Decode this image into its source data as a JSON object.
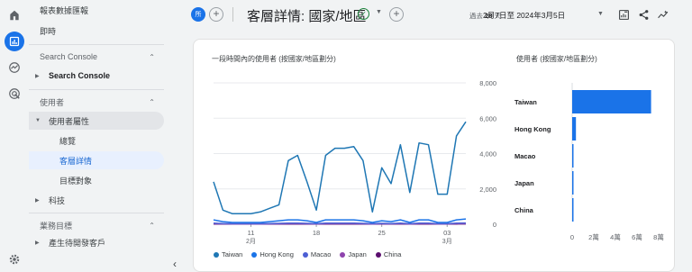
{
  "nav": {
    "reports_snapshot": "報表數據匯報",
    "realtime": "即時",
    "search_console_section": "Search Console",
    "search_console_item": "Search Console",
    "users_section": "使用者",
    "user_attributes": "使用者屬性",
    "overview": "總覽",
    "demographic_details": "客層詳情",
    "audiences": "目標對象",
    "tech": "科技",
    "business_goals": "業務目標",
    "leads": "產生待開發客戶"
  },
  "header": {
    "all_badge": "所",
    "title": "客層詳情: 國家/地區",
    "date_prefix": "過去",
    "date_days": "28",
    "date_unit": "天",
    "date_range": "2月7日至 2024年3月5日"
  },
  "line_chart_title": "一段時間內的使用者 (按國家/地區劃分)",
  "bar_chart_title": "使用者 (按國家/地區劃分)",
  "colors": {
    "accent": "#1a73e8",
    "Taiwan": "#1f77b4",
    "Hong Kong": "#1a73e8",
    "Macao": "#4d5fd4",
    "Japan": "#8e44ad",
    "China": "#5b0e6e"
  },
  "chart_data": [
    {
      "type": "line",
      "x": [
        "2月7日",
        "2月8日",
        "2月9日",
        "2月10日",
        "2月11日",
        "2月12日",
        "2月13日",
        "2月14日",
        "2月15日",
        "2月16日",
        "2月17日",
        "2月18日",
        "2月19日",
        "2月20日",
        "2月21日",
        "2月22日",
        "2月23日",
        "2月24日",
        "2月25日",
        "2月26日",
        "2月27日",
        "2月28日",
        "2月29日",
        "3月1日",
        "3月2日",
        "3月3日",
        "3月4日",
        "3月5日"
      ],
      "xticks": [
        {
          "label": "11",
          "sub": "2月",
          "x": "2月11日"
        },
        {
          "label": "18",
          "sub": "",
          "x": "2月18日"
        },
        {
          "label": "25",
          "sub": "",
          "x": "2月25日"
        },
        {
          "label": "03",
          "sub": "3月",
          "x": "3月3日"
        }
      ],
      "yticks": [
        "0",
        "2,000",
        "4,000",
        "6,000",
        "8,000"
      ],
      "ylim": [
        0,
        8000
      ],
      "grid": true,
      "series": [
        {
          "name": "Taiwan",
          "values": [
            2400,
            800,
            600,
            600,
            600,
            700,
            900,
            1100,
            3600,
            3900,
            2400,
            800,
            3900,
            4300,
            4300,
            4400,
            3600,
            700,
            3200,
            2300,
            4500,
            1800,
            4600,
            4500,
            1700,
            1700,
            5000,
            5800
          ]
        },
        {
          "name": "Hong Kong",
          "values": [
            250,
            150,
            100,
            100,
            100,
            100,
            150,
            200,
            250,
            250,
            200,
            100,
            250,
            250,
            250,
            250,
            200,
            100,
            200,
            150,
            250,
            100,
            250,
            250,
            100,
            100,
            250,
            300
          ]
        },
        {
          "name": "Macao",
          "values": [
            60,
            40,
            30,
            30,
            30,
            30,
            40,
            50,
            60,
            60,
            50,
            30,
            60,
            60,
            60,
            60,
            50,
            30,
            50,
            40,
            60,
            30,
            60,
            60,
            30,
            30,
            60,
            70
          ]
        },
        {
          "name": "Japan",
          "values": [
            30,
            20,
            15,
            15,
            15,
            15,
            20,
            25,
            30,
            30,
            25,
            15,
            30,
            30,
            30,
            30,
            25,
            15,
            25,
            20,
            30,
            15,
            30,
            30,
            15,
            15,
            30,
            35
          ]
        },
        {
          "name": "China",
          "values": [
            15,
            10,
            8,
            8,
            8,
            8,
            10,
            12,
            15,
            15,
            12,
            8,
            15,
            15,
            15,
            15,
            12,
            8,
            12,
            10,
            15,
            8,
            15,
            15,
            8,
            8,
            15,
            18
          ]
        }
      ]
    },
    {
      "type": "bar",
      "categories": [
        "Taiwan",
        "Hong Kong",
        "Macao",
        "Japan",
        "China"
      ],
      "values": [
        73000,
        3500,
        500,
        300,
        150
      ],
      "xticks": [
        "0",
        "2萬",
        "4萬",
        "6萬",
        "8萬"
      ],
      "xlim": [
        0,
        80000
      ]
    }
  ]
}
